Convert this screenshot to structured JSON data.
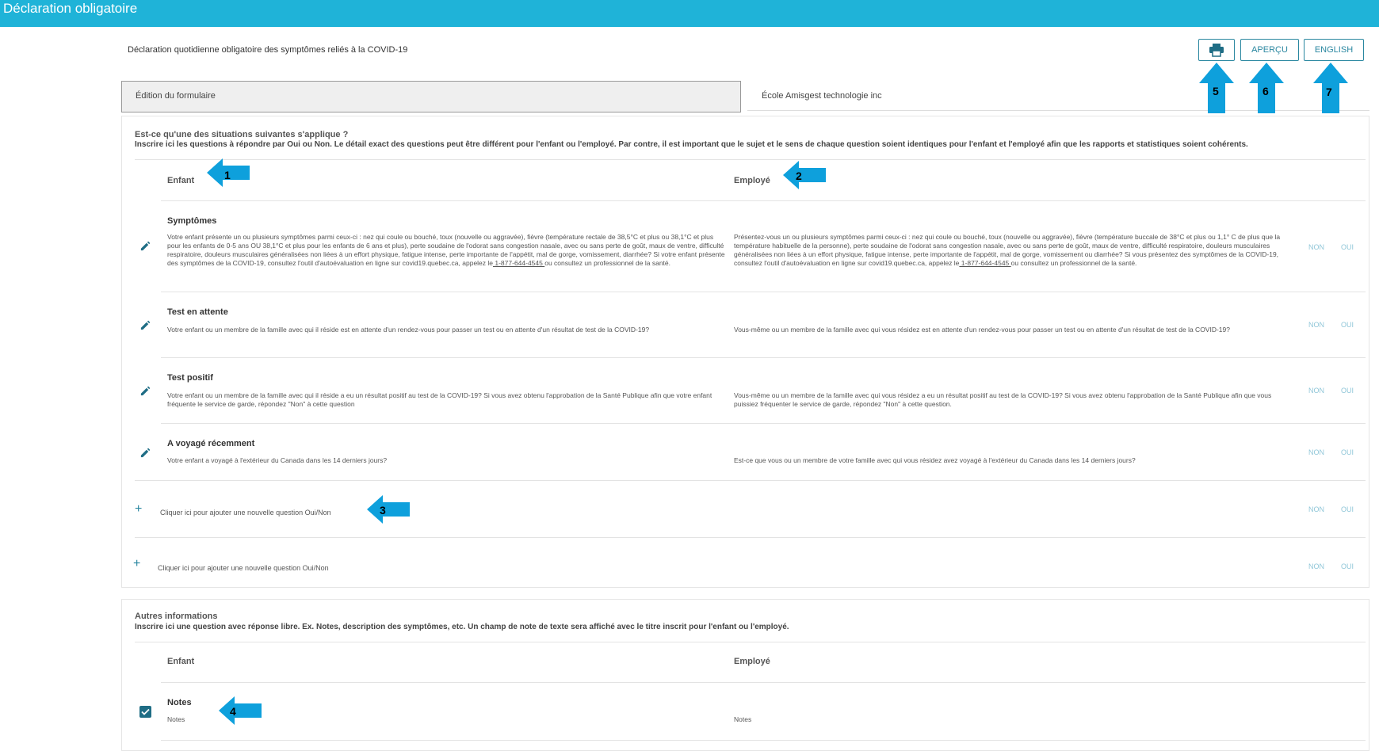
{
  "header": {
    "title": "Déclaration obligatoire"
  },
  "subtitle": "Déclaration quotidienne obligatoire des symptômes reliés à la COVID-19",
  "toolbar": {
    "print_icon": "printer-icon",
    "apercu_label": "APERÇU",
    "english_label": "ENGLISH"
  },
  "edition_label": "Édition du formulaire",
  "school_name": "École Amisgest technologie inc",
  "situations": {
    "title": "Est-ce qu'une des situations suivantes s'applique ?",
    "description": "Inscrire ici les questions à répondre par Oui ou Non. Le détail exact des questions peut être différent pour l'enfant ou l'employé. Par contre, il est important que le sujet et le sens de chaque question soient identiques pour l'enfant et l'employé afin que les rapports et statistiques soient cohérents.",
    "col_enfant": "Enfant",
    "col_employe": "Employé",
    "questions": [
      {
        "title": "Symptômes",
        "enfant_pre": "Votre enfant présente un ou plusieurs symptômes parmi ceux-ci : nez qui coule ou bouché, toux (nouvelle ou aggravée), fièvre (température rectale de 38,5°C et plus ou 38,1°C et plus pour les enfants de 0-5 ans OU 38,1°C et plus pour les enfants de 6 ans et plus), perte soudaine de l'odorat sans congestion nasale, avec ou sans perte de goût, maux de ventre, difficulté respiratoire, douleurs musculaires généralisées non liées à un effort physique, fatigue intense, perte importante de l'appétit, mal de gorge, vomissement, diarrhée? Si votre enfant présente des symptômes de la COVID-19, consultez l'outil d'autoévaluation en ligne sur covid19.quebec.ca, appelez le",
        "enfant_phone": " 1-877-644-4545 ",
        "enfant_post": "ou consultez un professionnel de la santé.",
        "employe_pre": "Présentez-vous un ou plusieurs symptômes parmi ceux-ci : nez qui coule ou bouché, toux (nouvelle ou aggravée), fièvre (température buccale de 38°C et plus ou 1,1° C de plus que la température habituelle de la personne), perte soudaine de l'odorat sans congestion nasale, avec ou sans perte de goût, maux de ventre, difficulté respiratoire, douleurs musculaires généralisées non liées à un effort physique, fatigue intense, perte importante de l'appétit, mal de gorge, vomissement ou diarrhée? Si vous présentez des symptômes de la COVID-19, consultez l'outil d'autoévaluation en ligne sur covid19.quebec.ca, appelez le",
        "employe_phone": " 1-877-644-4545 ",
        "employe_post": "ou consultez un professionnel de la santé.",
        "non": "NON",
        "oui": "OUI"
      },
      {
        "title": "Test en attente",
        "enfant": "Votre enfant ou un membre de la famille avec qui il réside est en attente d'un rendez-vous pour passer un test ou en attente d'un résultat de test de la COVID-19?",
        "employe": "Vous-même ou un membre de la famille avec qui vous résidez est en attente d'un rendez-vous pour passer un test ou en attente d'un résultat de test de la COVID-19?",
        "non": "NON",
        "oui": "OUI"
      },
      {
        "title": "Test positif",
        "enfant": "Votre enfant ou un membre de la famille avec qui il réside a eu un résultat positif au test de la COVID-19? Si vous avez obtenu l'approbation de la Santé Publique afin que votre enfant fréquente le service de garde, répondez \"Non\" à cette question",
        "employe": "Vous-même ou un membre de la famille avec qui vous résidez a eu un résultat positif au test de la COVID-19? Si vous avez obtenu l'approbation de la Santé Publique afin que vous puissiez fréquenter le service de garde, répondez \"Non\" à cette question.",
        "non": "NON",
        "oui": "OUI"
      },
      {
        "title": "A voyagé récemment",
        "enfant": "Votre enfant a voyagé à l'extérieur du Canada dans les 14 derniers jours?",
        "employe": "Est-ce que vous ou un membre de votre famille avec qui vous résidez avez voyagé à l'extérieur du Canada dans les 14 derniers jours?",
        "non": "NON",
        "oui": "OUI"
      }
    ],
    "add_rows": [
      {
        "label": "Cliquer ici pour ajouter une nouvelle question Oui/Non",
        "non": "NON",
        "oui": "OUI"
      },
      {
        "label": "Cliquer ici pour ajouter une nouvelle question Oui/Non",
        "non": "NON",
        "oui": "OUI"
      }
    ]
  },
  "autres": {
    "title": "Autres informations",
    "description": "Inscrire ici une question avec réponse libre. Ex. Notes, description des symptômes, etc. Un champ de note de texte sera affiché avec le titre inscrit pour l'enfant ou l'employé.",
    "col_enfant": "Enfant",
    "col_employe": "Employé",
    "notes_title": "Notes",
    "notes_enfant": "Notes",
    "notes_employe": "Notes"
  },
  "annotations": [
    "1",
    "2",
    "3",
    "4",
    "5",
    "6",
    "7"
  ],
  "colors": {
    "header": "#1fb3d8",
    "accent": "#2a87a0",
    "arrow": "#0ea0dc",
    "option": "#8fc6d8"
  }
}
